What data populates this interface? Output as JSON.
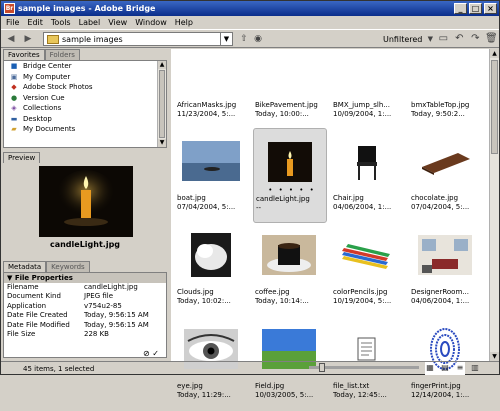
{
  "window": {
    "title": "sample images - Adobe Bridge"
  },
  "menu": [
    "File",
    "Edit",
    "Tools",
    "Label",
    "View",
    "Window",
    "Help"
  ],
  "toolbar": {
    "path": "sample images",
    "filter": "Unfiltered"
  },
  "panels": {
    "favorites_tab": "Favorites",
    "folders_tab": "Folders",
    "favorites": [
      "Bridge Center",
      "My Computer",
      "Adobe Stock Photos",
      "Version Cue",
      "Collections",
      "Desktop",
      "My Documents"
    ],
    "preview_tab": "Preview",
    "preview_caption": "candleLight.jpg",
    "metadata_tab": "Metadata",
    "keywords_tab": "Keywords",
    "file_properties": "File Properties",
    "metadata": [
      {
        "k": "Filename",
        "v": "candleLight.jpg"
      },
      {
        "k": "Document Kind",
        "v": "JPEG file"
      },
      {
        "k": "Application",
        "v": "v754u2-85"
      },
      {
        "k": "Date File Created",
        "v": "Today, 9:56:15 AM"
      },
      {
        "k": "Date File Modified",
        "v": "Today, 9:56:15 AM"
      },
      {
        "k": "File Size",
        "v": "228 KB"
      }
    ]
  },
  "files": [
    {
      "name": "AfricanMasks.jpg",
      "date": "11/23/2004, 5:..."
    },
    {
      "name": "BikePavement.jpg",
      "date": "Today, 10:00:..."
    },
    {
      "name": "BMX_jump_slh...",
      "date": "10/09/2004, 1:..."
    },
    {
      "name": "bmxTableTop.jpg",
      "date": "Today, 9:50:2..."
    },
    {
      "name": "boat.jpg",
      "date": "07/04/2004, 5:..."
    },
    {
      "name": "candleLight.jpg",
      "date": "--"
    },
    {
      "name": "Chair.jpg",
      "date": "04/06/2004, 1:..."
    },
    {
      "name": "chocolate.jpg",
      "date": "07/04/2004, 5:..."
    },
    {
      "name": "Clouds.jpg",
      "date": "Today, 10:02:..."
    },
    {
      "name": "coffee.jpg",
      "date": "Today, 10:14:..."
    },
    {
      "name": "colorPencils.jpg",
      "date": "10/19/2004, 5:..."
    },
    {
      "name": "DesignerRoom...",
      "date": "04/06/2004, 1:..."
    },
    {
      "name": "eye.jpg",
      "date": "Today, 11:29:..."
    },
    {
      "name": "Field.jpg",
      "date": "10/03/2005, 5:..."
    },
    {
      "name": "file_list.txt",
      "date": "Today, 12:45:..."
    },
    {
      "name": "fingerPrint.jpg",
      "date": "12/14/2004, 1:..."
    }
  ],
  "selected_stars": "• • • • •",
  "status": "45 items, 1 selected",
  "thumb_size": 0.1
}
